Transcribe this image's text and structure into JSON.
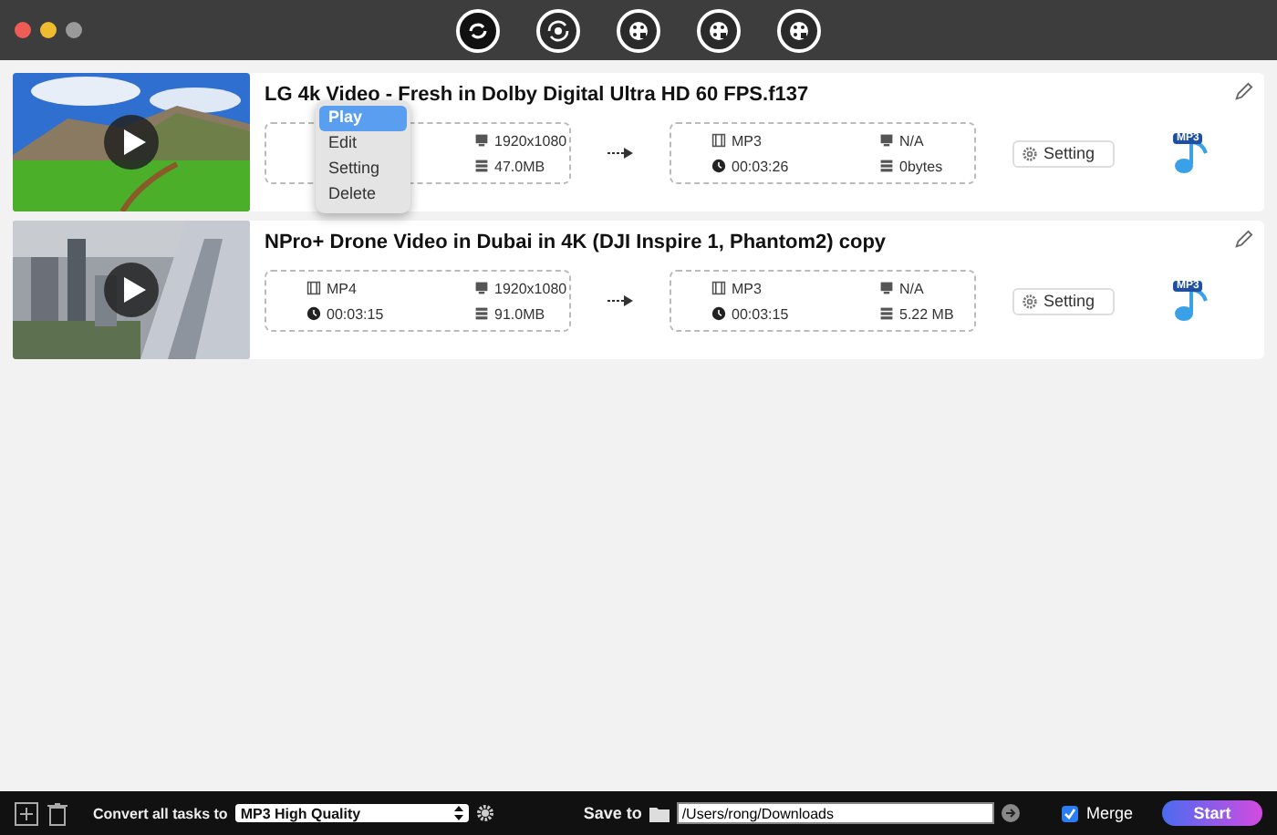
{
  "toolbar": {
    "tools": [
      {
        "selected": true
      },
      {
        "selected": false
      },
      {
        "selected": false
      },
      {
        "selected": false
      },
      {
        "selected": false
      }
    ]
  },
  "tasks": [
    {
      "title": "LG 4k Video - Fresh in Dolby Digital Ultra HD 60 FPS.f137",
      "source": {
        "resolution": "1920x1080",
        "size": "47.0MB"
      },
      "target": {
        "format": "MP3",
        "resolution": "N/A",
        "duration": "00:03:26",
        "size": "0bytes"
      },
      "setting": "Setting",
      "badge": "MP3"
    },
    {
      "title": "NPro+ Drone Video in Dubai in 4K (DJI Inspire 1, Phantom2) copy",
      "source": {
        "format": "MP4",
        "resolution": "1920x1080",
        "duration": "00:03:15",
        "size": "91.0MB"
      },
      "target": {
        "format": "MP3",
        "resolution": "N/A",
        "duration": "00:03:15",
        "size": "5.22 MB"
      },
      "setting": "Setting",
      "badge": "MP3"
    }
  ],
  "context_menu": {
    "items": [
      {
        "label": "Play",
        "selected": true
      },
      {
        "label": "Edit",
        "selected": false
      },
      {
        "label": "Setting",
        "selected": false
      },
      {
        "label": "Delete",
        "selected": false
      }
    ]
  },
  "footer": {
    "convert_label": "Convert all tasks to",
    "preset": "MP3 High Quality",
    "save_label": "Save to",
    "path": "/Users/rong/Downloads",
    "merge": {
      "label": "Merge",
      "checked": true
    },
    "start": "Start"
  }
}
